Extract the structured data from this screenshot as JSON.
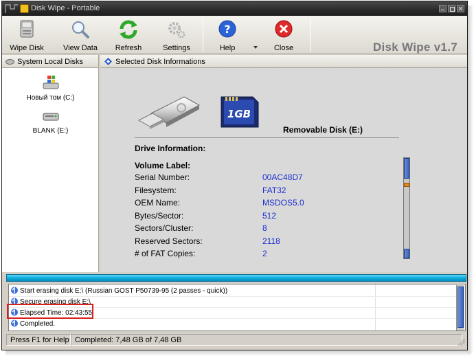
{
  "window": {
    "title": "Disk Wipe  - Portable",
    "brand": "Disk Wipe v1.7"
  },
  "toolbar": {
    "wipe_disk": "Wipe Disk",
    "view_data": "View Data",
    "refresh": "Refresh",
    "settings": "Settings",
    "help": "Help",
    "close": "Close"
  },
  "left_panel": {
    "header": "System Local Disks",
    "disks": [
      {
        "label": "Новый том (C:)",
        "icon": "windows-drive-icon"
      },
      {
        "label": "BLANK (E:)",
        "icon": "removable-drive-icon"
      }
    ]
  },
  "main": {
    "header": "Selected Disk Informations",
    "disk_title": "Removable Disk  (E:)",
    "sd_label": "1GB",
    "drive_info_heading": "Drive Information:",
    "volume_label_heading": "Volume Label:",
    "rows": [
      {
        "key": "Serial Number:",
        "value": "00AC48D7"
      },
      {
        "key": "Filesystem:",
        "value": "FAT32"
      },
      {
        "key": "OEM Name:",
        "value": "MSDOS5.0"
      },
      {
        "key": "Bytes/Sector:",
        "value": "512"
      },
      {
        "key": "Sectors/Cluster:",
        "value": "8"
      },
      {
        "key": "Reserved Sectors:",
        "value": "2118"
      },
      {
        "key": "# of FAT Copies:",
        "value": "2"
      }
    ],
    "value_color": "#1e2fd0"
  },
  "progress": {
    "fraction": 1.0,
    "color": "#0aa7d8"
  },
  "log": [
    "Start erasing disk E:\\ (Russian GOST P50739-95 (2 passes - quick))",
    "Secure erasing disk E:\\",
    "Elapsed Time: 02:43:55",
    "Completed."
  ],
  "status": {
    "help_hint": "Press F1 for Help",
    "completed": "Completed: 7,48 GB of 7,48 GB"
  },
  "colors": {
    "highlight": "#d8201c",
    "titlebar": "#2a2a2a",
    "progress": "#0aa7d8"
  }
}
